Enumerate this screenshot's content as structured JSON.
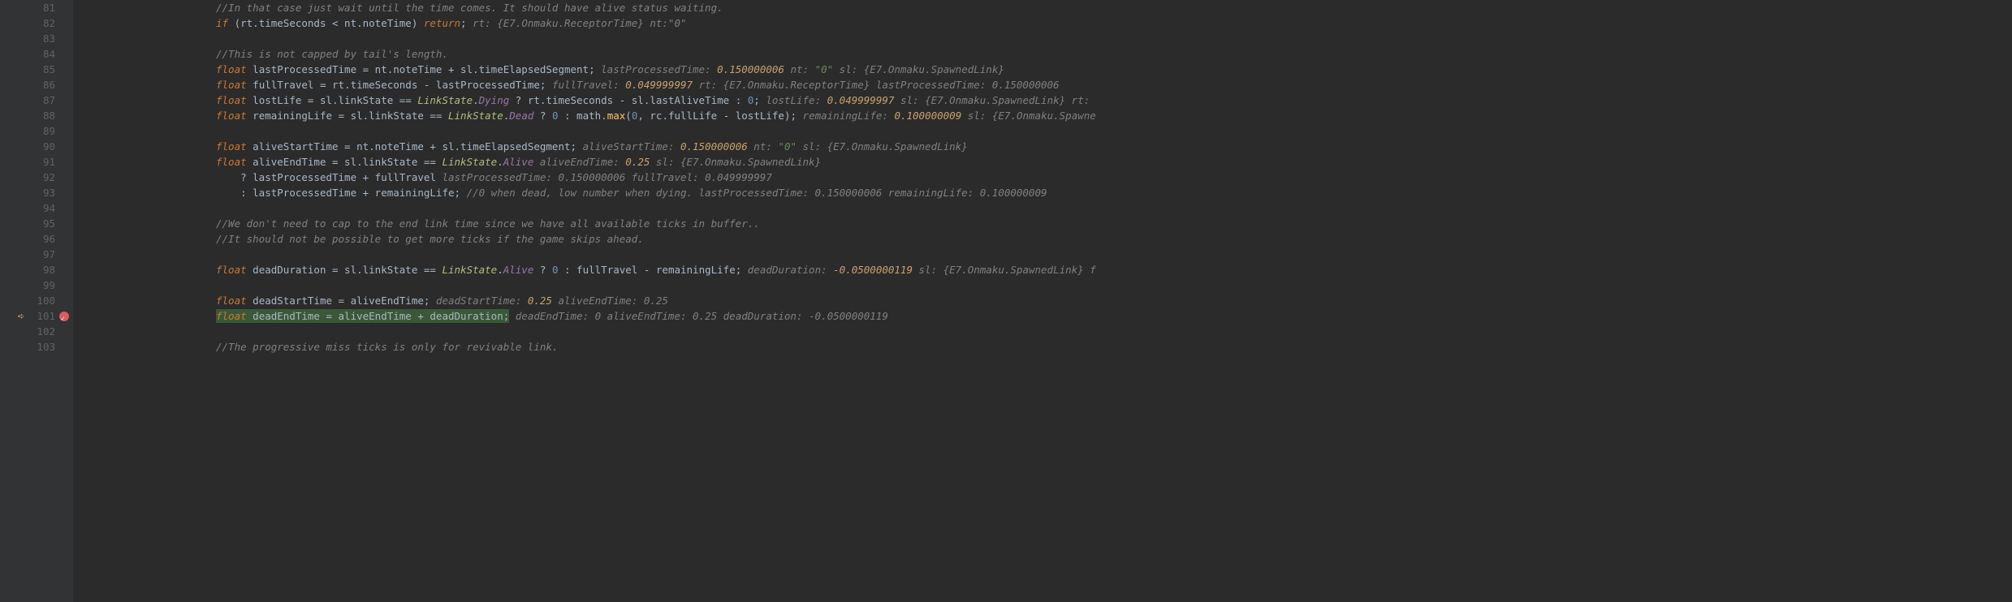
{
  "lines": [
    {
      "n": 81,
      "indent": 0,
      "tokens": [
        [
          "com",
          "//In that case just wait until the time comes. It should have alive status waiting."
        ]
      ]
    },
    {
      "n": 82,
      "indent": 0,
      "tokens": [
        [
          "kw",
          "if"
        ],
        [
          "op",
          " (rt.timeSeconds < nt.noteTime) "
        ],
        [
          "kw",
          "return"
        ],
        [
          "op",
          ";   "
        ],
        [
          "ann",
          "rt: {E7.Onmaku.ReceptorTime}  nt:\"0\""
        ]
      ]
    },
    {
      "n": 83,
      "indent": 0,
      "tokens": []
    },
    {
      "n": 84,
      "indent": 0,
      "tokens": [
        [
          "com",
          "//This is not capped by tail's length."
        ]
      ]
    },
    {
      "n": 85,
      "indent": 0,
      "tokens": [
        [
          "kw",
          "float"
        ],
        [
          "op",
          " lastProcessedTime = nt.noteTime + sl.timeElapsedSegment;   "
        ],
        [
          "ann",
          "lastProcessedTime: "
        ],
        [
          "ann-val",
          "0.150000006"
        ],
        [
          "ann",
          "  nt: "
        ],
        [
          "ann-str",
          "\"0\""
        ],
        [
          "ann",
          "  sl: {E7.Onmaku.SpawnedLink}"
        ]
      ]
    },
    {
      "n": 86,
      "indent": 0,
      "tokens": [
        [
          "kw",
          "float"
        ],
        [
          "op",
          " fullTravel = rt.timeSeconds - lastProcessedTime;   "
        ],
        [
          "ann",
          "fullTravel: "
        ],
        [
          "ann-val",
          "0.049999997"
        ],
        [
          "ann",
          "  rt: {E7.Onmaku.ReceptorTime}  lastProcessedTime: 0.150000006"
        ]
      ]
    },
    {
      "n": 87,
      "indent": 0,
      "tokens": [
        [
          "kw",
          "float"
        ],
        [
          "op",
          " lostLife = sl.linkState == "
        ],
        [
          "ns",
          "LinkState"
        ],
        [
          "op",
          "."
        ],
        [
          "enum",
          "Dying"
        ],
        [
          "op",
          " ? rt.timeSeconds - sl.lastAliveTime : "
        ],
        [
          "num",
          "0"
        ],
        [
          "op",
          ";   "
        ],
        [
          "ann",
          "lostLife: "
        ],
        [
          "ann-val",
          "0.049999997"
        ],
        [
          "ann",
          "  sl: {E7.Onmaku.SpawnedLink}  rt:"
        ]
      ]
    },
    {
      "n": 88,
      "indent": 0,
      "tokens": [
        [
          "kw",
          "float"
        ],
        [
          "op",
          " remainingLife = sl.linkState == "
        ],
        [
          "ns",
          "LinkState"
        ],
        [
          "op",
          "."
        ],
        [
          "enum",
          "Dead"
        ],
        [
          "op",
          " ? "
        ],
        [
          "num",
          "0"
        ],
        [
          "op",
          " : math."
        ],
        [
          "fn",
          "max"
        ],
        [
          "op",
          "("
        ],
        [
          "num",
          "0"
        ],
        [
          "op",
          ", rc.fullLife - lostLife);   "
        ],
        [
          "ann",
          "remainingLife: "
        ],
        [
          "ann-val",
          "0.100000009"
        ],
        [
          "ann",
          "  sl: {E7.Onmaku.Spawne"
        ]
      ]
    },
    {
      "n": 89,
      "indent": 0,
      "tokens": []
    },
    {
      "n": 90,
      "indent": 0,
      "tokens": [
        [
          "kw",
          "float"
        ],
        [
          "op",
          " aliveStartTime = nt.noteTime + sl.timeElapsedSegment;   "
        ],
        [
          "ann",
          "aliveStartTime: "
        ],
        [
          "ann-val",
          "0.150000006"
        ],
        [
          "ann",
          "  nt: "
        ],
        [
          "ann-str",
          "\"0\""
        ],
        [
          "ann",
          "  sl: {E7.Onmaku.SpawnedLink}"
        ]
      ]
    },
    {
      "n": 91,
      "indent": 0,
      "tokens": [
        [
          "kw",
          "float"
        ],
        [
          "op",
          " aliveEndTime = sl.linkState == "
        ],
        [
          "ns",
          "LinkState"
        ],
        [
          "op",
          "."
        ],
        [
          "enum",
          "Alive"
        ],
        [
          "op",
          "   "
        ],
        [
          "ann",
          "aliveEndTime: "
        ],
        [
          "ann-val",
          "0.25"
        ],
        [
          "ann",
          "  sl: {E7.Onmaku.SpawnedLink}"
        ]
      ]
    },
    {
      "n": 92,
      "indent": 1,
      "tokens": [
        [
          "op",
          "? lastProcessedTime + fullTravel   "
        ],
        [
          "ann",
          "lastProcessedTime: 0.150000006  fullTravel: 0.049999997"
        ]
      ]
    },
    {
      "n": 93,
      "indent": 1,
      "tokens": [
        [
          "op",
          ": lastProcessedTime + remainingLife; "
        ],
        [
          "com",
          "//0 when dead, low number when dying."
        ],
        [
          "ann",
          "  lastProcessedTime: 0.150000006  remainingLife: 0.100000009"
        ]
      ]
    },
    {
      "n": 94,
      "indent": 0,
      "tokens": []
    },
    {
      "n": 95,
      "indent": 0,
      "tokens": [
        [
          "com",
          "//We don't need to cap to the end link time since we have all available ticks in buffer.."
        ]
      ]
    },
    {
      "n": 96,
      "indent": 0,
      "tokens": [
        [
          "com",
          "//It should not be possible to get more ticks if the game skips ahead."
        ]
      ]
    },
    {
      "n": 97,
      "indent": 0,
      "tokens": []
    },
    {
      "n": 98,
      "indent": 0,
      "tokens": [
        [
          "kw",
          "float"
        ],
        [
          "op",
          " deadDuration = sl.linkState == "
        ],
        [
          "ns",
          "LinkState"
        ],
        [
          "op",
          "."
        ],
        [
          "enum",
          "Alive"
        ],
        [
          "op",
          " ? "
        ],
        [
          "num",
          "0"
        ],
        [
          "op",
          " : fullTravel - remainingLife;   "
        ],
        [
          "ann",
          "deadDuration: "
        ],
        [
          "ann-val",
          "-0.0500000119"
        ],
        [
          "ann",
          "  sl: {E7.Onmaku.SpawnedLink}  f"
        ]
      ]
    },
    {
      "n": 99,
      "indent": 0,
      "tokens": []
    },
    {
      "n": 100,
      "indent": 0,
      "tokens": [
        [
          "kw",
          "float"
        ],
        [
          "op",
          " deadStartTime = aliveEndTime;   "
        ],
        [
          "ann",
          "deadStartTime: "
        ],
        [
          "ann-val",
          "0.25"
        ],
        [
          "ann",
          "  aliveEndTime: 0.25"
        ]
      ]
    },
    {
      "n": 101,
      "indent": 0,
      "exec": true,
      "tokens": [
        [
          "hl-start",
          ""
        ],
        [
          "kw",
          "float"
        ],
        [
          "op",
          " deadEndTime = aliveEndTime + deadDuration;"
        ],
        [
          "hl-end",
          ""
        ],
        [
          "op",
          "   "
        ],
        [
          "ann",
          "deadEndTime: 0  aliveEndTime: 0.25  deadDuration: -0.0500000119"
        ]
      ]
    },
    {
      "n": 102,
      "indent": 0,
      "tokens": []
    },
    {
      "n": 103,
      "indent": 0,
      "tokens": [
        [
          "com",
          "//The progressive miss ticks is only for revivable link."
        ]
      ]
    }
  ]
}
